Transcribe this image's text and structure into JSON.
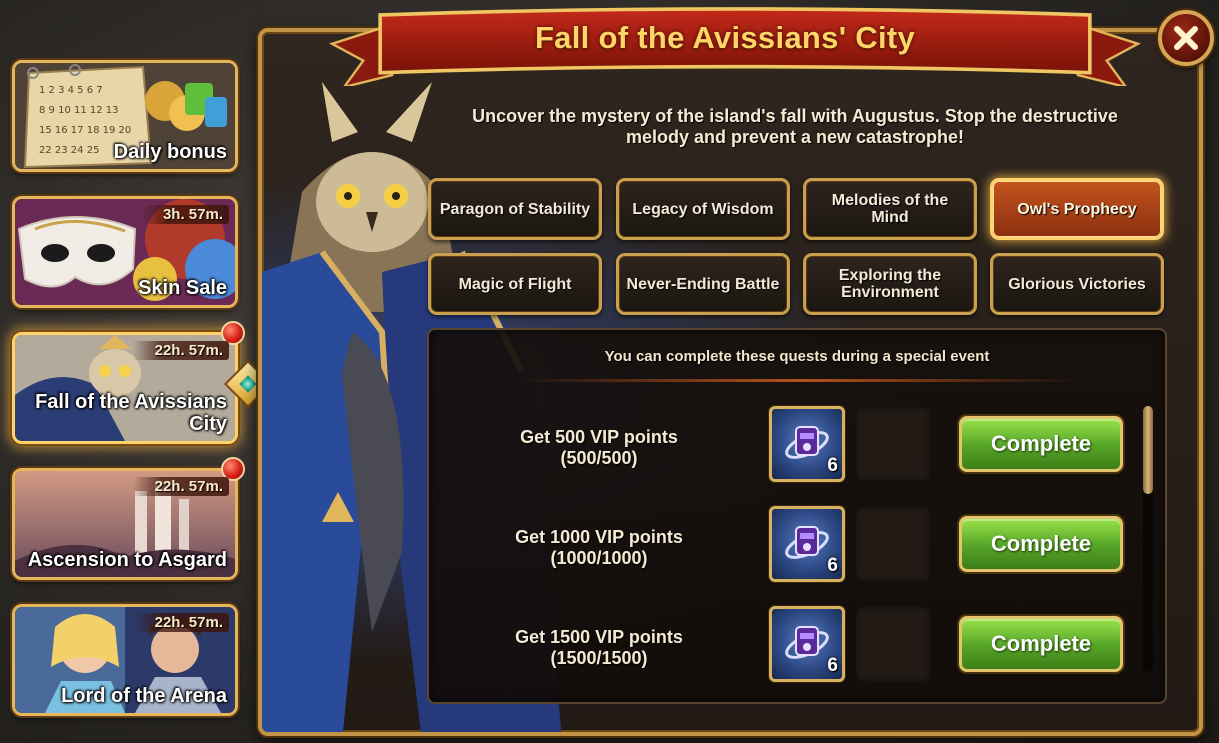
{
  "sidebar": {
    "cards": [
      {
        "title": "Daily bonus",
        "timer": "",
        "notification": false,
        "active": false
      },
      {
        "title": "Skin Sale",
        "timer": "3h. 57m.",
        "notification": false,
        "active": false
      },
      {
        "title": "Fall of the Avissians City",
        "timer": "22h. 57m.",
        "notification": true,
        "active": true
      },
      {
        "title": "Ascension to Asgard",
        "timer": "22h. 57m.",
        "notification": true,
        "active": false
      },
      {
        "title": "Lord of the Arena",
        "timer": "22h. 57m.",
        "notification": false,
        "active": false
      }
    ]
  },
  "window": {
    "title": "Fall of the Avissians' City",
    "description": "Uncover the mystery of the island's fall with Augustus. Stop the destructive melody and prevent a new catastrophe!",
    "close_icon": "close-icon"
  },
  "tabs": [
    {
      "label": "Paragon of Stability",
      "active": false
    },
    {
      "label": "Legacy of Wisdom",
      "active": false
    },
    {
      "label": "Melodies of the Mind",
      "active": false
    },
    {
      "label": "Owl's Prophecy",
      "active": true
    },
    {
      "label": "Magic of Flight",
      "active": false
    },
    {
      "label": "Never-Ending Battle",
      "active": false
    },
    {
      "label": "Exploring the Environment",
      "active": false
    },
    {
      "label": "Glorious Victories",
      "active": false
    }
  ],
  "quests": {
    "header": "You can complete these quests during a special event",
    "items": [
      {
        "name": "Get 500 VIP points",
        "progress": "(500/500)",
        "reward_icon": "artifact-sphere-icon",
        "reward_count": "6",
        "button_label": "Complete"
      },
      {
        "name": "Get 1000 VIP points",
        "progress": "(1000/1000)",
        "reward_icon": "artifact-sphere-icon",
        "reward_count": "6",
        "button_label": "Complete"
      },
      {
        "name": "Get 1500 VIP points",
        "progress": "(1500/1500)",
        "reward_icon": "artifact-sphere-icon",
        "reward_count": "6",
        "button_label": "Complete"
      }
    ]
  },
  "colors": {
    "accent_gold": "#e6b75a",
    "banner_red": "#a61e14",
    "active_tab": "#c4551e",
    "complete_green": "#5aa82a"
  }
}
